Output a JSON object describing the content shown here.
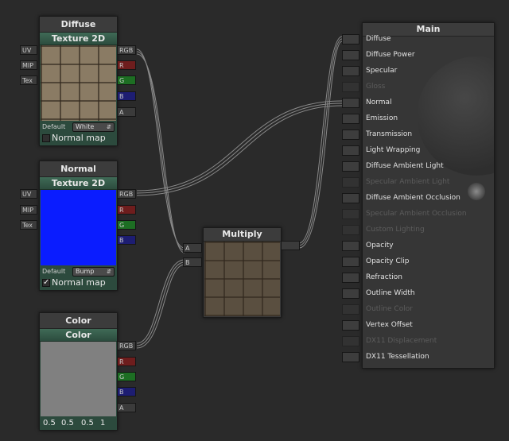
{
  "diffuse_node": {
    "title": "Diffuse",
    "subtitle": "Texture 2D",
    "inputs": [
      "UV",
      "MIP",
      "Tex"
    ],
    "outputs": [
      "RGB",
      "R",
      "G",
      "B",
      "A"
    ],
    "default_label": "Default",
    "default_value": "White",
    "normal_map_label": "Normal map",
    "normal_map_checked": false
  },
  "normal_node": {
    "title": "Normal",
    "subtitle": "Texture 2D",
    "inputs": [
      "UV",
      "MIP",
      "Tex"
    ],
    "outputs": [
      "RGB",
      "R",
      "G",
      "B",
      "A"
    ],
    "default_label": "Default",
    "default_value": "Bump",
    "normal_map_label": "Normal map",
    "normal_map_checked": true
  },
  "color_node": {
    "title": "Color",
    "subtitle": "Color",
    "outputs": [
      "RGB",
      "R",
      "G",
      "B",
      "A"
    ],
    "values": [
      "0.5",
      "0.5",
      "0.5",
      "1"
    ]
  },
  "multiply_node": {
    "title": "Multiply",
    "inputs": [
      "A",
      "B"
    ]
  },
  "main_node": {
    "title": "Main",
    "slots": [
      {
        "label": "Diffuse",
        "enabled": true
      },
      {
        "label": "Diffuse Power",
        "enabled": true
      },
      {
        "label": "Specular",
        "enabled": true
      },
      {
        "label": "Gloss",
        "enabled": false
      },
      {
        "label": "Normal",
        "enabled": true
      },
      {
        "label": "Emission",
        "enabled": true
      },
      {
        "label": "Transmission",
        "enabled": true
      },
      {
        "label": "Light Wrapping",
        "enabled": true
      },
      {
        "label": "Diffuse Ambient Light",
        "enabled": true
      },
      {
        "label": "Specular Ambient Light",
        "enabled": false
      },
      {
        "label": "Diffuse Ambient Occlusion",
        "enabled": true
      },
      {
        "label": "Specular Ambient Occlusion",
        "enabled": false
      },
      {
        "label": "Custom Lighting",
        "enabled": false
      },
      {
        "label": "Opacity",
        "enabled": true
      },
      {
        "label": "Opacity Clip",
        "enabled": true
      },
      {
        "label": "Refraction",
        "enabled": true
      },
      {
        "label": "Outline Width",
        "enabled": true
      },
      {
        "label": "Outline Color",
        "enabled": false
      },
      {
        "label": "Vertex Offset",
        "enabled": true
      },
      {
        "label": "DX11 Displacement",
        "enabled": false
      },
      {
        "label": "DX11 Tessellation",
        "enabled": true
      }
    ]
  },
  "colors": {
    "canvas": "#2a2a2a",
    "node_header": "#3f6a56",
    "normal_preview": "#0a1cff",
    "color_preview": "#808080",
    "port_r": "#6e1d1d",
    "port_g": "#1d6e23",
    "port_b": "#1d1d72"
  }
}
